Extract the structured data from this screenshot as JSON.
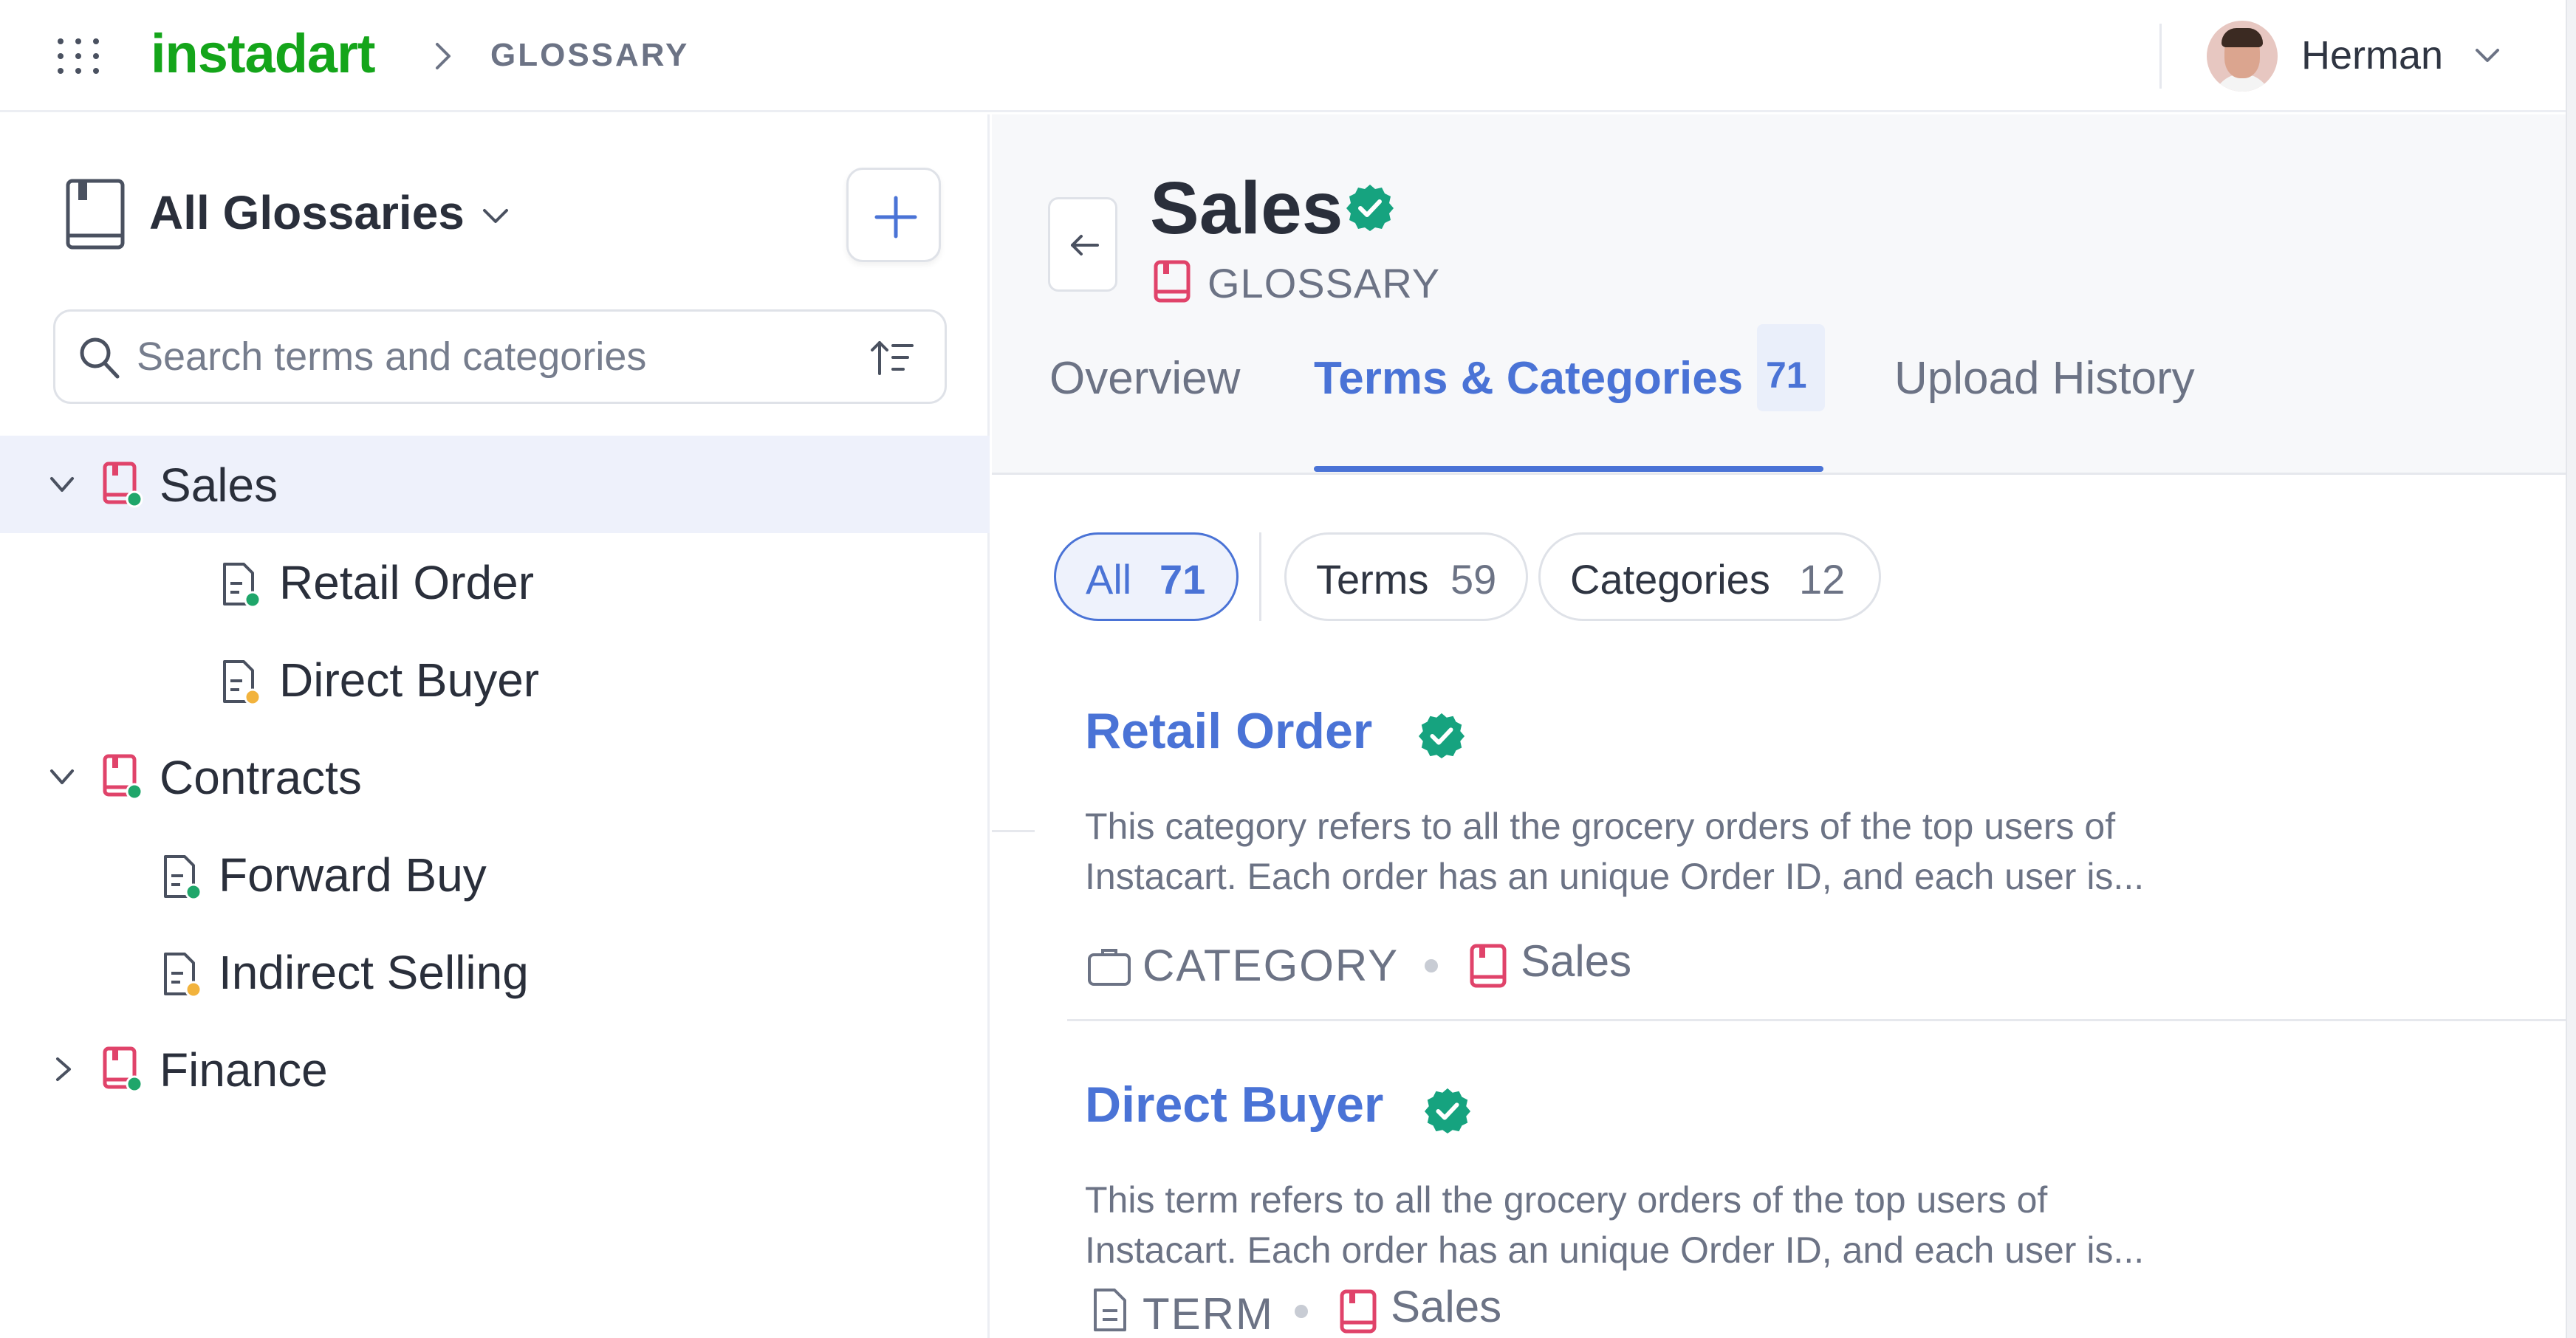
{
  "app": {
    "logo_text": "instadart"
  },
  "header": {
    "breadcrumb": "GLOSSARY",
    "user_name": "Herman"
  },
  "sidebar": {
    "title": "All Glossaries",
    "search_placeholder": "Search terms and categories",
    "tree": [
      {
        "label": "Sales",
        "kind": "glossary",
        "status": "green",
        "expanded": true,
        "selected": true
      },
      {
        "label": "Retail Order",
        "kind": "category",
        "status": "green"
      },
      {
        "label": "Direct Buyer",
        "kind": "term",
        "status": "yellow"
      },
      {
        "label": "Contracts",
        "kind": "glossary",
        "status": "green",
        "expanded": true
      },
      {
        "label": "Forward Buy",
        "kind": "category",
        "status": "green"
      },
      {
        "label": "Indirect Selling",
        "kind": "term",
        "status": "yellow"
      },
      {
        "label": "Finance",
        "kind": "glossary",
        "status": "green",
        "expanded": false
      }
    ]
  },
  "main": {
    "title": "Sales",
    "subtype": "GLOSSARY",
    "tabs": [
      {
        "label": "Overview"
      },
      {
        "label": "Terms & Categories",
        "count": "71",
        "active": true
      },
      {
        "label": "Upload History"
      }
    ],
    "filters": [
      {
        "label": "All",
        "count": "71",
        "active": true
      },
      {
        "label": "Terms",
        "count": "59"
      },
      {
        "label": "Categories",
        "count": "12"
      }
    ],
    "cards": [
      {
        "title": "Retail Order",
        "desc_line1": "This category refers to all the grocery orders of the top users of",
        "desc_line2": "Instacart. Each order has an unique Order ID, and each user is...",
        "type": "CATEGORY",
        "glossary": "Sales"
      },
      {
        "title": "Direct Buyer",
        "desc_line1": "This term refers to all the grocery orders of the top users of",
        "desc_line2": "Instacart. Each order has an unique Order ID, and each user is...",
        "type": "TERM",
        "glossary": "Sales"
      }
    ]
  },
  "colors": {
    "brand": "#14a51a",
    "accent": "#4a73d6",
    "verified": "#16a37f",
    "glossary_icon": "#e0436a",
    "status_green": "#1fa66a",
    "status_yellow": "#f2b33d"
  },
  "icons": [
    "apps-grid-icon",
    "chevron-right-icon",
    "chevron-down-icon",
    "book-icon",
    "plus-icon",
    "search-icon",
    "sort-icon",
    "glossary-icon",
    "category-icon",
    "term-icon",
    "verified-badge-icon",
    "arrow-left-icon",
    "briefcase-icon",
    "document-icon"
  ]
}
